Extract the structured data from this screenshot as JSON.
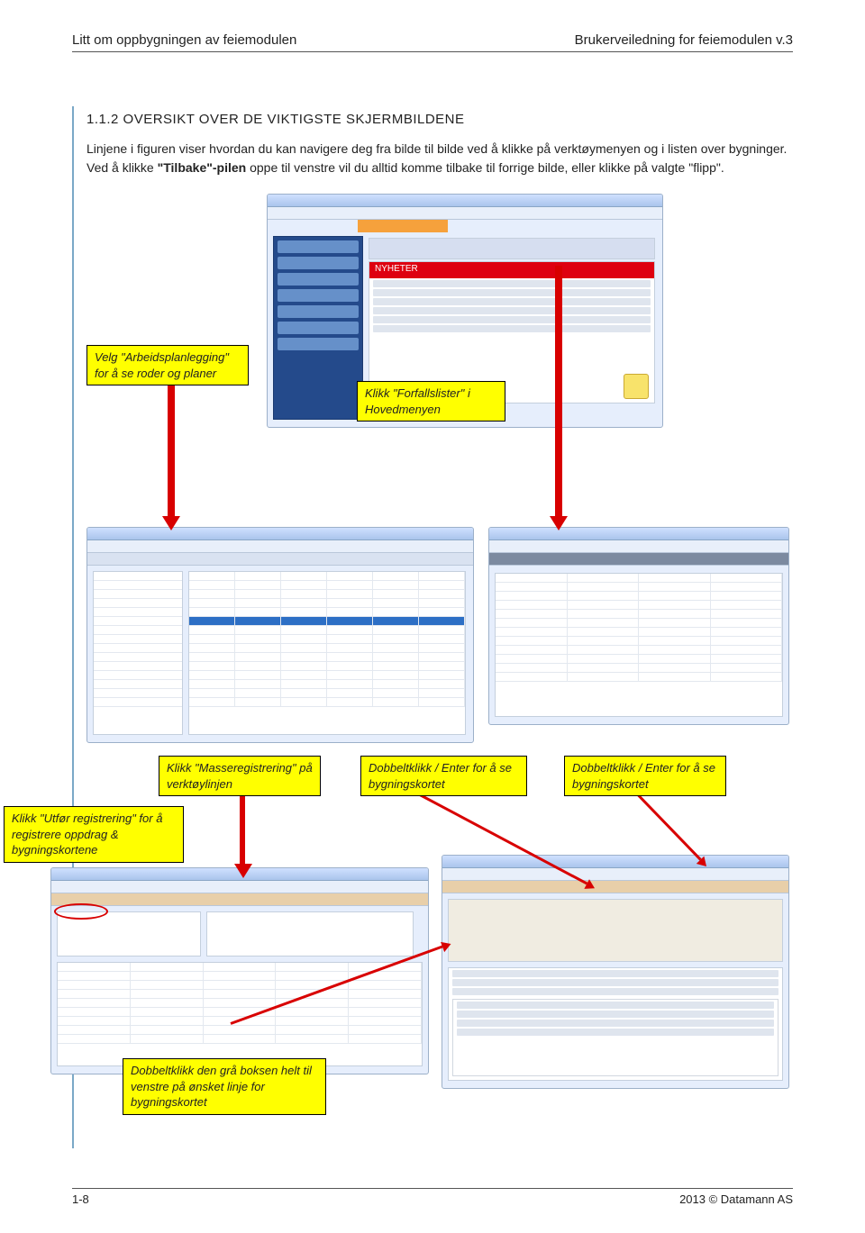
{
  "header": {
    "left": "Litt om oppbygningen av feiemodulen",
    "right": "Brukerveiledning for feiemodulen v.3"
  },
  "section": {
    "heading": "1.1.2  OVERSIKT OVER DE VIKTIGSTE SKJERMBILDENE",
    "para1": "Linjene i figuren viser hvordan du kan navigere deg fra bilde til bilde ved å klikke på verktøymenyen og i listen over bygninger. Ved å klikke ",
    "bold": "\"Tilbake\"-pilen",
    "para2": " oppe til venstre vil du alltid komme tilbake til forrige bilde, eller klikke på valgte \"flipp\"."
  },
  "callouts": {
    "c1": "Velg \"Arbeidsplanlegging\" for å se roder og planer",
    "c2": "Klikk \"Forfallslister\" i Hovedmenyen",
    "c3": "Klikk \"Masseregistrering\" på verktøylinjen",
    "c4": "Dobbeltklikk / Enter for å se bygningskortet",
    "c5": "Dobbeltklikk / Enter for å se bygningskortet",
    "c6": "Klikk \"Utfør registrering\" for å registrere oppdrag & bygningskortene",
    "c7": "Dobbeltklikk den grå boksen helt til venstre på ønsket linje for bygningskortet"
  },
  "footer": {
    "left": "1-8",
    "right": "2013 © Datamann AS"
  }
}
